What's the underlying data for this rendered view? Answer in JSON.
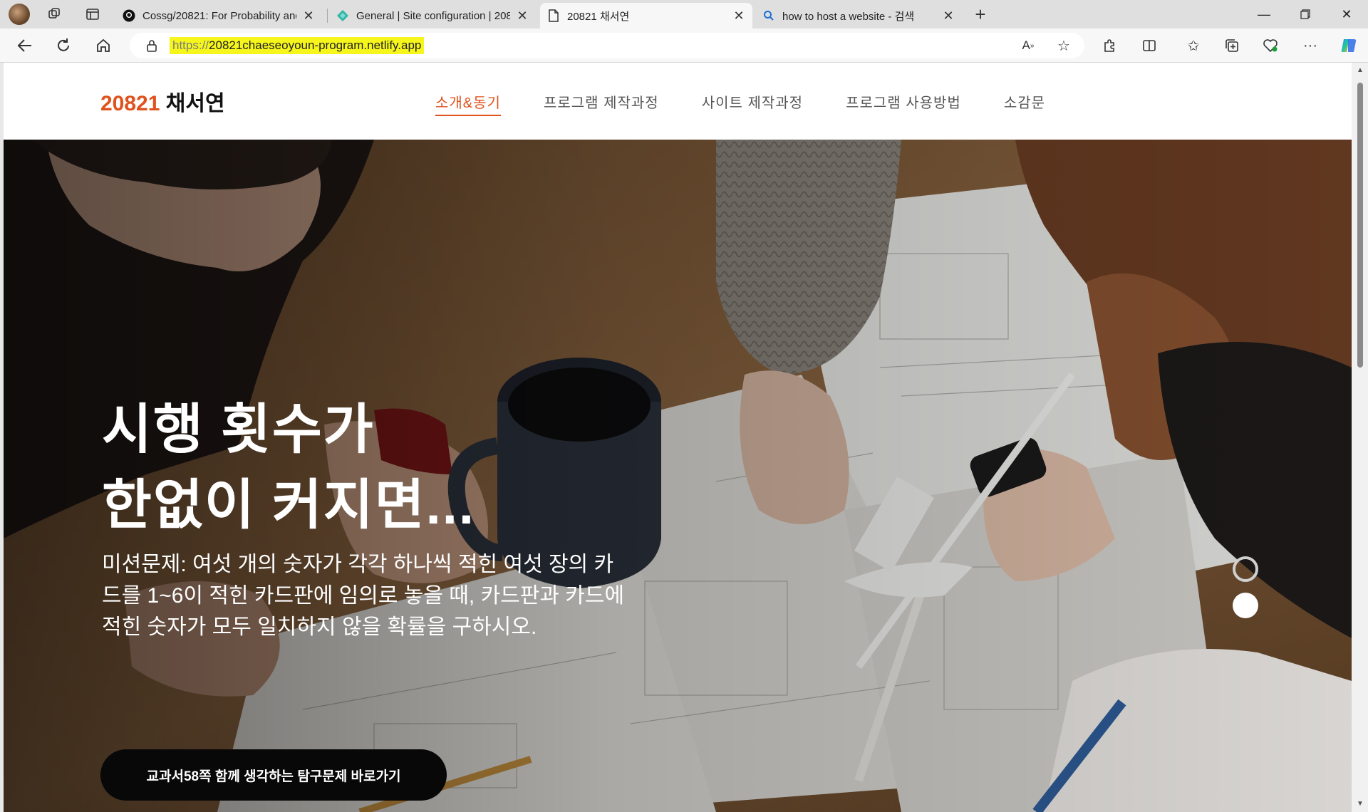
{
  "browser": {
    "tabs": [
      {
        "label": "Cossg/20821: For Probability and",
        "icon": "github-icon"
      },
      {
        "label": "General | Site configuration | 208",
        "icon": "netlify-icon"
      },
      {
        "label": "20821 채서연",
        "icon": "page-icon"
      },
      {
        "label": "how to host a website - 검색",
        "icon": "search-icon"
      }
    ],
    "url_scheme": "https://",
    "url_host": "20821chaeseoyoun-program.netlify.app",
    "annotation_color": "#d61f26"
  },
  "site": {
    "logo_number": "20821",
    "logo_name": "채서연",
    "accent": "#e0521d",
    "menu": [
      {
        "label": "소개&동기"
      },
      {
        "label": "프로그램 제작과정"
      },
      {
        "label": "사이트 제작과정"
      },
      {
        "label": "프로그램 사용방법"
      },
      {
        "label": "소감문"
      }
    ]
  },
  "hero": {
    "title_line1": "시행 횟수가",
    "title_line2": "한없이 커지면...",
    "desc_line1": "미션문제: 여섯 개의 숫자가 각각 하나씩 적힌 여섯 장의 카",
    "desc_line2": "드를 1~6이 적힌 카드판에 임의로 놓을 때, 카드판과 카드에",
    "desc_line3": "적힌 숫자가 모두 일치하지 않을 확률을 구하시오.",
    "button_label": "교과서58쪽 함께 생각하는 탐구문제 바로가기"
  }
}
